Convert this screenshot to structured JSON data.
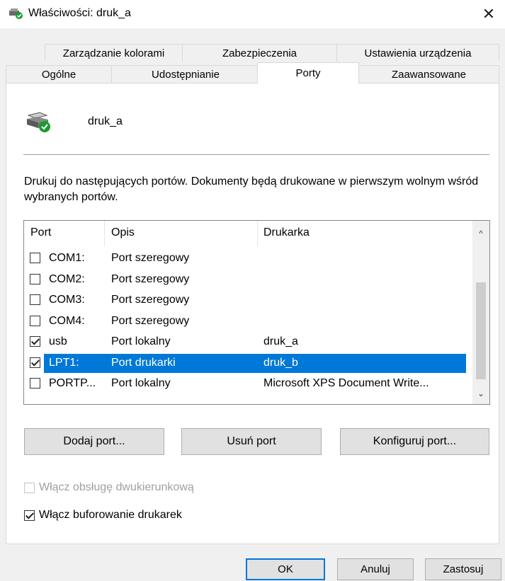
{
  "window": {
    "title": "Właściwości: druk_a",
    "close_glyph": "✕"
  },
  "tabs_back": [
    "Zarządzanie kolorami",
    "Zabezpieczenia",
    "Ustawienia urządzenia"
  ],
  "tabs_front": [
    "Ogólne",
    "Udostępnianie",
    "Porty",
    "Zaawansowane"
  ],
  "active_tab": "Porty",
  "printer": {
    "name": "druk_a",
    "icon": "printer-ready-icon"
  },
  "description": "Drukuj do następujących portów. Dokumenty będą drukowane w pierwszym wolnym wśród wybranych portów.",
  "ports": {
    "columns": [
      "Port",
      "Opis",
      "Drukarka"
    ],
    "rows": [
      {
        "checked": false,
        "port": "COM1:",
        "desc": "Port szeregowy",
        "printer": ""
      },
      {
        "checked": false,
        "port": "COM2:",
        "desc": "Port szeregowy",
        "printer": ""
      },
      {
        "checked": false,
        "port": "COM3:",
        "desc": "Port szeregowy",
        "printer": ""
      },
      {
        "checked": false,
        "port": "COM4:",
        "desc": "Port szeregowy",
        "printer": ""
      },
      {
        "checked": true,
        "port": "usb",
        "desc": "Port lokalny",
        "printer": "druk_a"
      },
      {
        "checked": true,
        "port": "LPT1:",
        "desc": "Port drukarki",
        "printer": "druk_b",
        "selected": true
      },
      {
        "checked": false,
        "port": "PORTP...",
        "desc": "Port lokalny",
        "printer": "Microsoft XPS Document Write..."
      }
    ],
    "scroll_up": "^",
    "scroll_down": "⌄"
  },
  "buttons": {
    "add": "Dodaj port...",
    "remove": "Usuń port",
    "configure": "Konfiguruj port..."
  },
  "options": {
    "bidirectional": {
      "label": "Włącz obsługę dwukierunkową",
      "checked": false,
      "disabled": true
    },
    "spooling": {
      "label": "Włącz buforowanie drukarek",
      "checked": true
    }
  },
  "footer": {
    "ok": "OK",
    "cancel": "Anuluj",
    "apply": "Zastosuj"
  },
  "colors": {
    "accent": "#0078d7",
    "ready_green": "#1a9b2f"
  }
}
